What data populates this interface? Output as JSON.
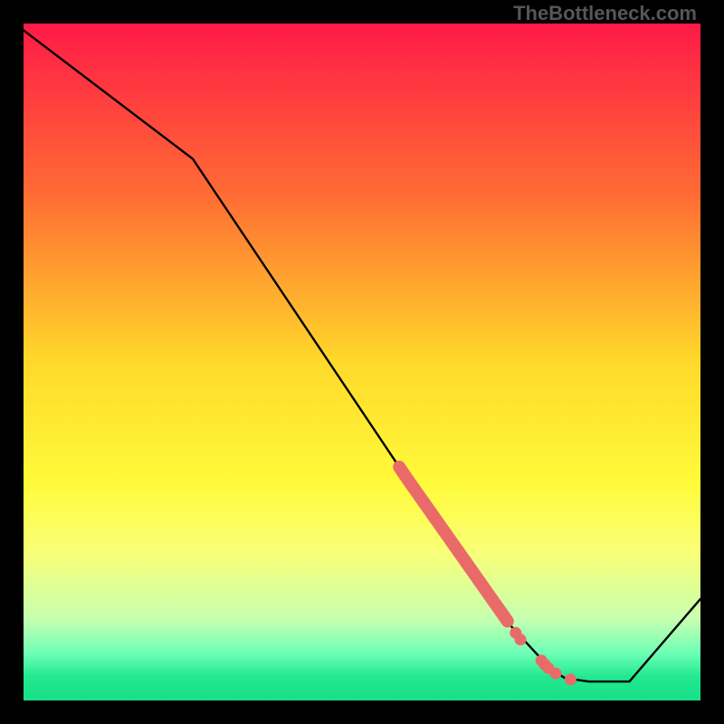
{
  "watermark": "TheBottleneck.com",
  "chart_data": {
    "type": "line",
    "title": "",
    "xlabel": "",
    "ylabel": "",
    "xlim": [
      0,
      100
    ],
    "ylim": [
      0,
      100
    ],
    "gradient_stops": [
      {
        "offset": 0,
        "color": "#ff1a47"
      },
      {
        "offset": 0.25,
        "color": "#ff6b34"
      },
      {
        "offset": 0.5,
        "color": "#ffd92a"
      },
      {
        "offset": 0.68,
        "color": "#fffb3a"
      },
      {
        "offset": 0.78,
        "color": "#f9ff77"
      },
      {
        "offset": 0.88,
        "color": "#c7ffb0"
      },
      {
        "offset": 0.93,
        "color": "#6dffb5"
      },
      {
        "offset": 0.965,
        "color": "#22e88f"
      },
      {
        "offset": 1.0,
        "color": "#19df89"
      }
    ],
    "curve": [
      {
        "x": 0,
        "y": 99
      },
      {
        "x": 25,
        "y": 80
      },
      {
        "x": 56.5,
        "y": 33
      },
      {
        "x": 72.0,
        "y": 11
      },
      {
        "x": 78.0,
        "y": 4.5
      },
      {
        "x": 80.0,
        "y": 3.3
      },
      {
        "x": 83.5,
        "y": 2.8
      },
      {
        "x": 89.5,
        "y": 2.8
      },
      {
        "x": 100,
        "y": 15
      }
    ],
    "highlight_band": {
      "description": "thick salmon segment with dots along the curve",
      "color": "#ea6a6a",
      "thick_range_x": [
        55.5,
        71.5
      ],
      "dots": [
        {
          "x": 72.7,
          "y": 10.0
        },
        {
          "x": 73.4,
          "y": 9.0
        },
        {
          "x": 76.5,
          "y": 5.9
        },
        {
          "x": 77.0,
          "y": 5.3
        },
        {
          "x": 77.5,
          "y": 4.8
        },
        {
          "x": 78.6,
          "y": 4.0
        },
        {
          "x": 80.8,
          "y": 3.1
        }
      ]
    }
  }
}
